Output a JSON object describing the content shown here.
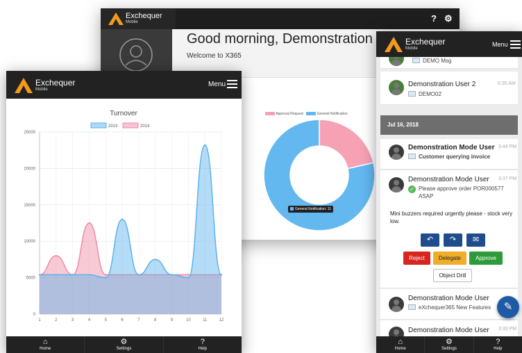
{
  "brand": {
    "name": "Exchequer",
    "sub": "Mobile"
  },
  "back": {
    "greeting": "Good morning, Demonstration Us",
    "welcome": "Welcome to X365",
    "top_icons": [
      "?",
      "⚙"
    ],
    "donut": {
      "legend": [
        "Approval Request",
        "General Notification"
      ],
      "tooltip": "General Notification: 11",
      "values": [
        3,
        11
      ],
      "colors": [
        "#f7a1b5",
        "#63b8f0"
      ]
    }
  },
  "left": {
    "menu": "Menu",
    "chart_data": {
      "type": "area",
      "title": "Turnover",
      "x": [
        1,
        2,
        3,
        4,
        5,
        6,
        7,
        8,
        9,
        10,
        11,
        12
      ],
      "series": [
        {
          "name": "2014",
          "color": "#f08aa3",
          "values": [
            5400,
            8000,
            5400,
            12500,
            5400,
            5400,
            5400,
            5400,
            5400,
            5400,
            5400,
            5400
          ]
        },
        {
          "name": "2013",
          "color": "#5bb1ec",
          "values": [
            5400,
            5400,
            5400,
            5400,
            5000,
            13000,
            5400,
            7500,
            5400,
            5000,
            23200,
            5400
          ]
        }
      ],
      "ylim": [
        0,
        25000
      ],
      "yticks": [
        0,
        5000,
        10000,
        15000,
        20000,
        25000
      ]
    },
    "tabs": [
      {
        "icon": "home-icon",
        "label": "Home",
        "glyph": "⌂"
      },
      {
        "icon": "gear-icon",
        "label": "Settings",
        "glyph": "⚙"
      },
      {
        "icon": "help-icon",
        "label": "Help",
        "glyph": "?"
      }
    ]
  },
  "right": {
    "menu": "Menu",
    "messages_top": [
      {
        "name": "",
        "time": "",
        "subject": "DEMO Msg"
      },
      {
        "name": "Demonstration User 2",
        "time": "6:35 AM",
        "subject": "DEMO02"
      }
    ],
    "date_header": "Jul 16, 2018",
    "msg1": {
      "name": "Demonstration Mode User",
      "time": "3:44 PM",
      "subject": "Customer querying invoice"
    },
    "msg2": {
      "name": "Demonstration Mode User",
      "time": "3:37 PM",
      "subject": "Please approve order POR000577 ASAP",
      "line1": "Please approve order POR000577",
      "line2": "ASAP",
      "body": "Mini buzzers required urgently please - stock very low."
    },
    "actions": {
      "reject": "Reject",
      "delegate": "Delegate",
      "approve": "Approve",
      "drill": "Object Drill"
    },
    "msg3": {
      "name": "Demonstration Mode User",
      "time": "",
      "subject": "eXchequer365 New Features"
    },
    "msg4": {
      "name": "Demonstration Mode User",
      "time": "3:33 PM"
    },
    "tabs": [
      {
        "icon": "home-icon",
        "label": "Home",
        "glyph": "⌂"
      },
      {
        "icon": "gear-icon",
        "label": "Settings",
        "glyph": "⚙"
      },
      {
        "icon": "help-icon",
        "label": "Help",
        "glyph": "?"
      }
    ]
  }
}
